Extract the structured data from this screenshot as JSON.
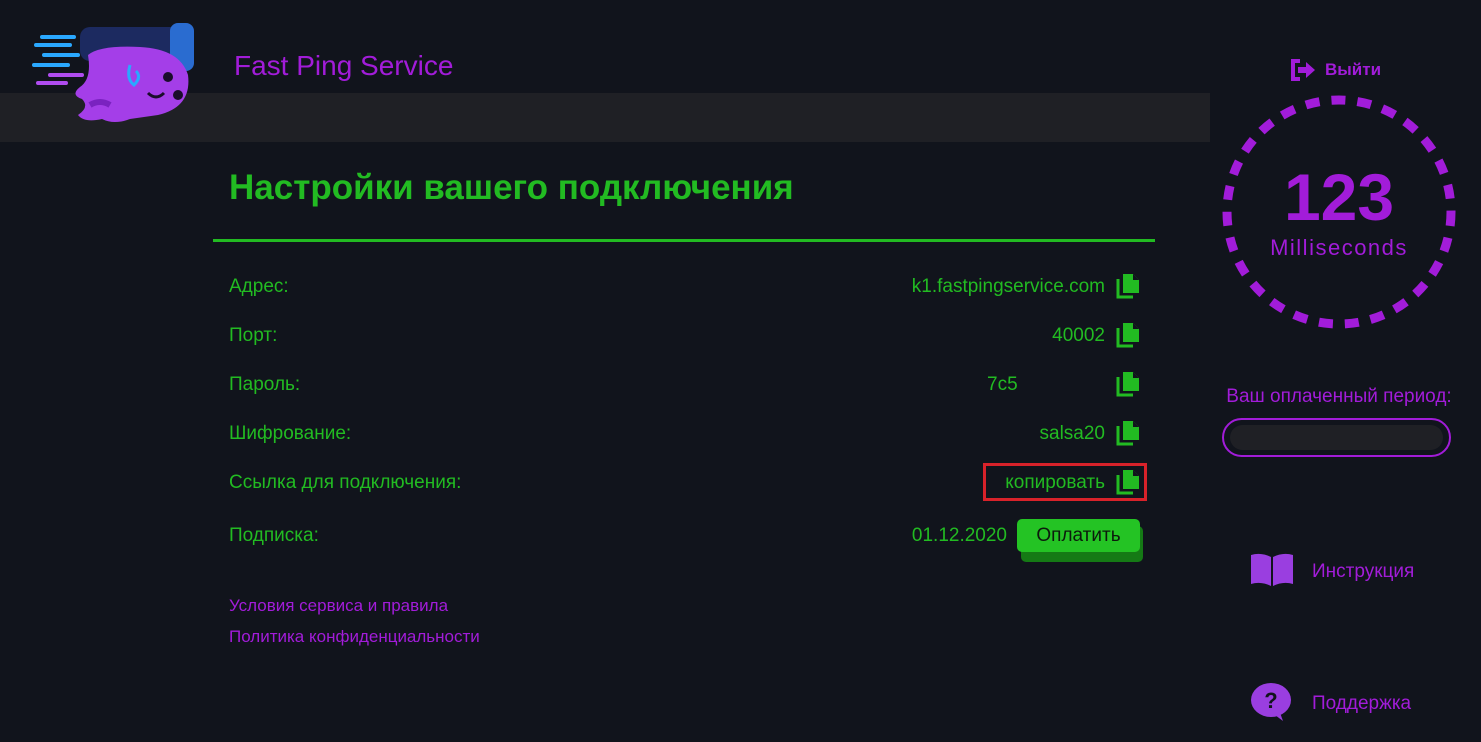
{
  "brand": {
    "name": "Fast Ping Service",
    "logo_icon": "jellyfish-mascot"
  },
  "header": {
    "logout_label": "Выйти",
    "logout_icon": "sign-out-icon"
  },
  "page_title": "Настройки вашего подключения",
  "settings": {
    "address": {
      "label": "Адрес:",
      "value": "k1.fastpingservice.com"
    },
    "port": {
      "label": "Порт:",
      "value": "40002"
    },
    "password": {
      "label": "Пароль:",
      "value": "7c5"
    },
    "encryption": {
      "label": "Шифрование:",
      "value": "salsa20"
    },
    "link": {
      "label": "Ссылка для подключения:",
      "value": "копировать"
    },
    "subscription": {
      "label": "Подписка:",
      "value": "01.12.2020",
      "pay_label": "Оплатить"
    }
  },
  "footer": {
    "terms": "Условия сервиса и правила",
    "privacy": "Политика конфиденциальности"
  },
  "ping": {
    "value": "123",
    "unit": "Milliseconds"
  },
  "period": {
    "label": "Ваш оплаченный период:",
    "value": ""
  },
  "side_links": {
    "instructions": "Инструкция",
    "support": "Поддержка"
  },
  "colors": {
    "background": "#11141c",
    "band": "#1f2025",
    "accent_green": "#22bb22",
    "accent_purple": "#a21cd9",
    "highlight_red": "#d8222a"
  }
}
